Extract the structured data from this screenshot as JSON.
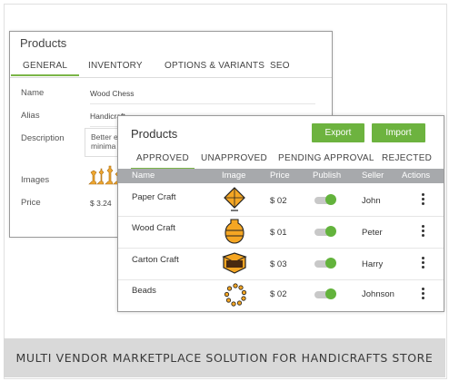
{
  "back_card": {
    "title": "Products",
    "tabs": [
      "GENERAL",
      "INVENTORY",
      "OPTIONS & VARIANTS",
      "SEO"
    ],
    "fields": {
      "name_label": "Name",
      "name_value": "Wood Chess",
      "alias_label": "Alias",
      "alias_value": "Handicraft",
      "description_label": "Description",
      "description_value_line1": "Better e",
      "description_value_line2": "minima",
      "images_label": "Images",
      "price_label": "Price",
      "price_value": "$ 3.24"
    }
  },
  "front_card": {
    "title": "Products",
    "export_label": "Export",
    "import_label": "Import",
    "tabs": [
      "APPROVED",
      "UNAPPROVED",
      "PENDING APPROVAL",
      "REJECTED"
    ],
    "columns": [
      "Name",
      "Image",
      "Price",
      "Publish",
      "Seller",
      "Actions"
    ],
    "rows": [
      {
        "name": "Paper Craft",
        "image": "kite-icon",
        "price": "$ 02",
        "publish": true,
        "seller": "John"
      },
      {
        "name": "Wood Craft",
        "image": "vase-icon",
        "price": "$ 01",
        "publish": true,
        "seller": "Peter"
      },
      {
        "name": "Carton Craft",
        "image": "box-icon",
        "price": "$ 03",
        "publish": true,
        "seller": "Harry"
      },
      {
        "name": "Beads",
        "image": "bead-necklace-icon",
        "price": "$ 02",
        "publish": true,
        "seller": "Johnson"
      }
    ]
  },
  "footer": {
    "text": "MULTI VENDOR MARKETPLACE SOLUTION FOR HANDICRAFTS STORE"
  },
  "colors": {
    "accent": "#6db33f",
    "header": "#a7a9ac",
    "icon_fill": "#f5a623"
  }
}
